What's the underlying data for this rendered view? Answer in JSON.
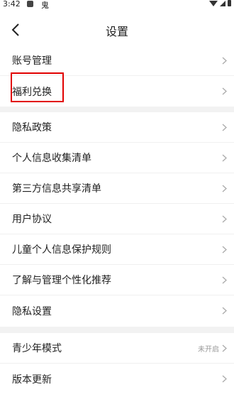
{
  "status_bar": {
    "time": "3:42",
    "app_text": "鬼"
  },
  "header": {
    "title": "设置"
  },
  "groups": [
    {
      "items": [
        {
          "label": "账号管理"
        },
        {
          "label": "福利兑换"
        }
      ]
    },
    {
      "items": [
        {
          "label": "隐私政策"
        },
        {
          "label": "个人信息收集清单"
        },
        {
          "label": "第三方信息共享清单"
        },
        {
          "label": "用户协议"
        },
        {
          "label": "儿童个人信息保护规则"
        },
        {
          "label": "了解与管理个性化推荐"
        },
        {
          "label": "隐私设置"
        }
      ]
    },
    {
      "items": [
        {
          "label": "青少年模式",
          "value": "未开启"
        },
        {
          "label": "版本更新"
        }
      ]
    }
  ],
  "colors": {
    "highlight": "#e10000",
    "divider": "#f2f2f2"
  },
  "icons": {
    "back": "chevron-left-icon",
    "row_arrow": "chevron-right-icon"
  }
}
